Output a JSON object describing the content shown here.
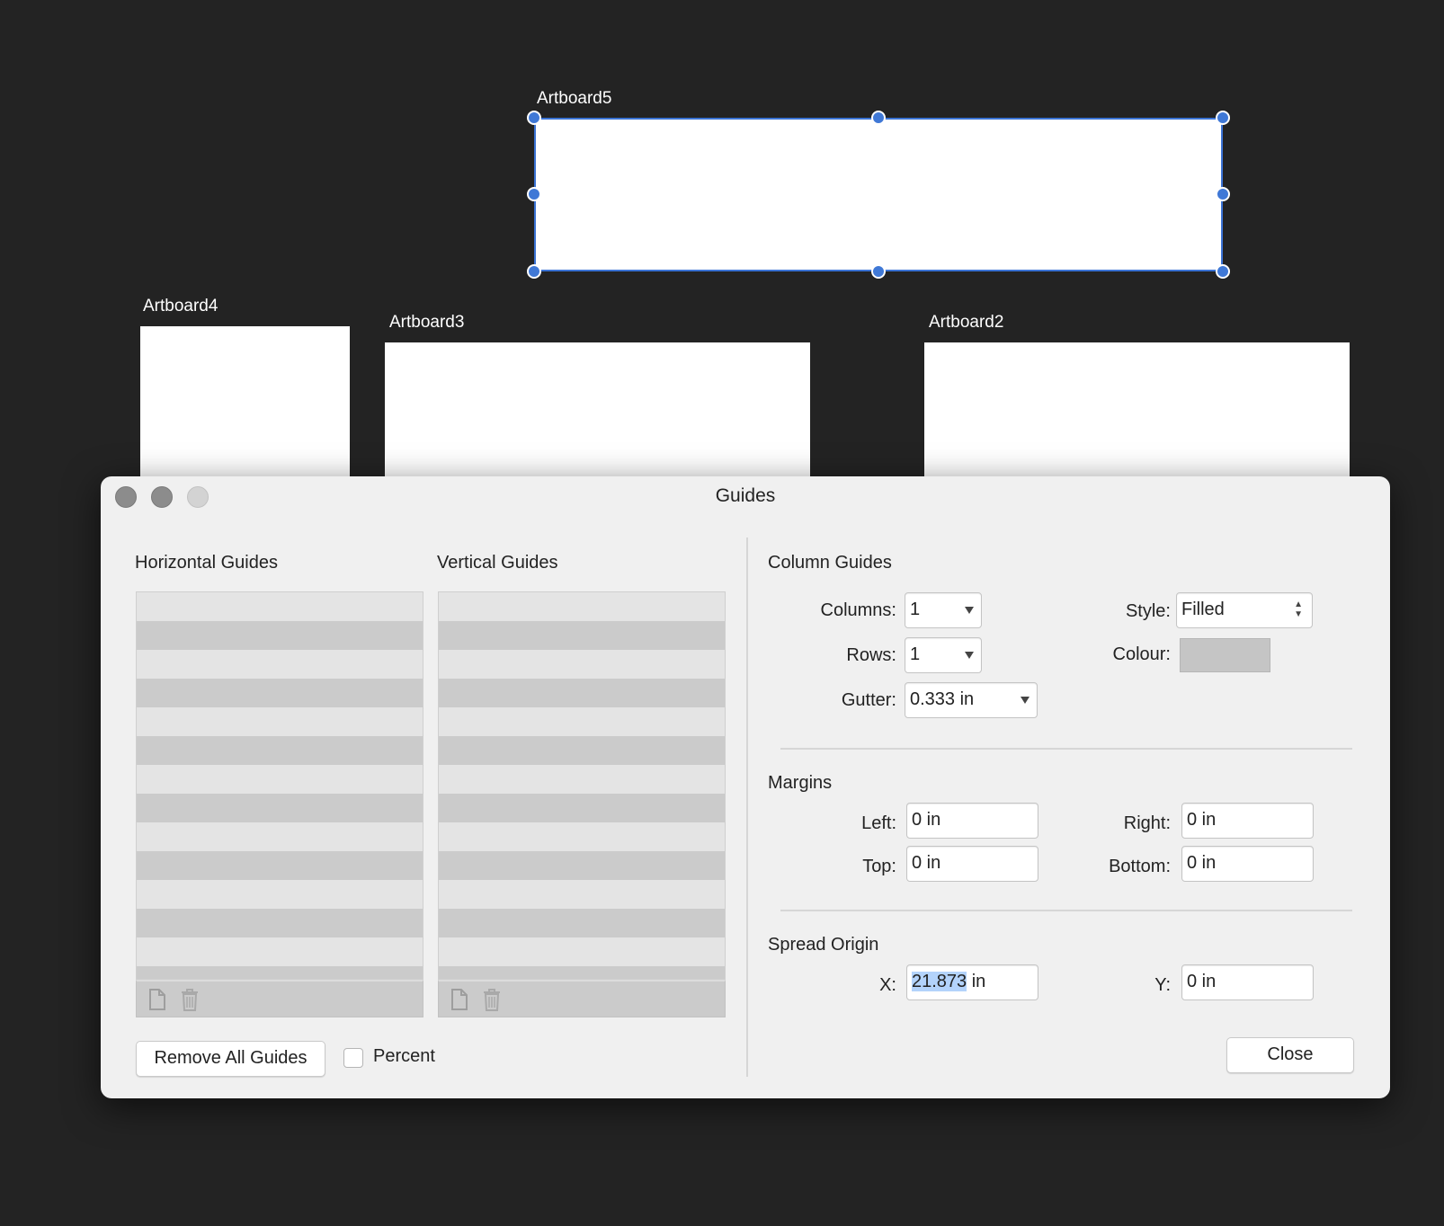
{
  "artboards": {
    "artboard5": "Artboard5",
    "artboard4": "Artboard4",
    "artboard3": "Artboard3",
    "artboard2": "Artboard2"
  },
  "dialog": {
    "title": "Guides",
    "horizontal_guides_label": "Horizontal Guides",
    "vertical_guides_label": "Vertical Guides",
    "remove_all_label": "Remove All Guides",
    "percent_label": "Percent",
    "percent_checked": false,
    "column_guides": {
      "heading": "Column Guides",
      "columns_label": "Columns:",
      "columns_value": "1",
      "rows_label": "Rows:",
      "rows_value": "1",
      "gutter_label": "Gutter:",
      "gutter_value": "0.333 in",
      "style_label": "Style:",
      "style_value": "Filled",
      "colour_label": "Colour:",
      "colour_value": "#c5c5c5"
    },
    "margins": {
      "heading": "Margins",
      "left_label": "Left:",
      "left_value": "0 in",
      "right_label": "Right:",
      "right_value": "0 in",
      "top_label": "Top:",
      "top_value": "0 in",
      "bottom_label": "Bottom:",
      "bottom_value": "0 in"
    },
    "spread_origin": {
      "heading": "Spread Origin",
      "x_label": "X:",
      "x_value_selected": "21.873",
      "x_unit": " in",
      "y_label": "Y:",
      "y_value": "0 in"
    },
    "close_label": "Close"
  },
  "colors": {
    "canvas_bg": "#232323",
    "selection_accent": "#3b73d4",
    "dialog_bg": "#f0f0f0"
  }
}
